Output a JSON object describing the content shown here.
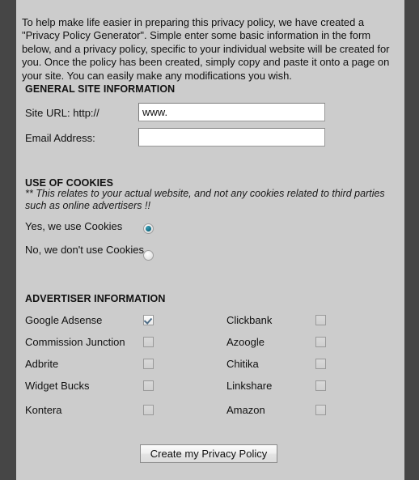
{
  "intro": {
    "text": "To help make life easier in preparing this privacy policy, we have created a \"Privacy Policy Generator\". Simple enter some basic information in the form below, and a privacy policy, specific to your individual website will be created for you. Once the policy has been created, simply copy and paste it onto a page on your site. You can easily make any modifications you wish."
  },
  "general_site_information": {
    "heading": "GENERAL SITE INFORMATION",
    "site_url_label": "Site URL: http://",
    "site_url_value": "www.",
    "email_label": "Email Address:",
    "email_value": ""
  },
  "use_of_cookies": {
    "heading": "USE OF COOKIES",
    "note": "** This relates to your actual website, and not any cookies related to third parties such as online advertisers !!",
    "options": [
      {
        "label": "Yes, we use Cookies",
        "selected": true
      },
      {
        "label": "No, we don't use Cookies",
        "selected": false
      }
    ]
  },
  "advertiser_information": {
    "heading": "ADVERTISER INFORMATION",
    "left_column": [
      {
        "label": "Google Adsense",
        "checked": true
      },
      {
        "label": "Commission Junction",
        "checked": false
      },
      {
        "label": "Adbrite",
        "checked": false
      },
      {
        "label": "Widget Bucks",
        "checked": false
      },
      {
        "label": "Kontera",
        "checked": false
      }
    ],
    "right_column": [
      {
        "label": "Clickbank",
        "checked": false
      },
      {
        "label": "Azoogle",
        "checked": false
      },
      {
        "label": "Chitika",
        "checked": false
      },
      {
        "label": "Linkshare",
        "checked": false
      },
      {
        "label": "Amazon",
        "checked": false
      }
    ]
  },
  "submit": {
    "label": "Create my Privacy Policy"
  },
  "colors": {
    "page_background": "#464646",
    "content_background": "#cccccc",
    "text": "#111111",
    "radio_selected": "#147089",
    "checkbox_check": "#4f6d86",
    "input_background": "#ffffff"
  }
}
